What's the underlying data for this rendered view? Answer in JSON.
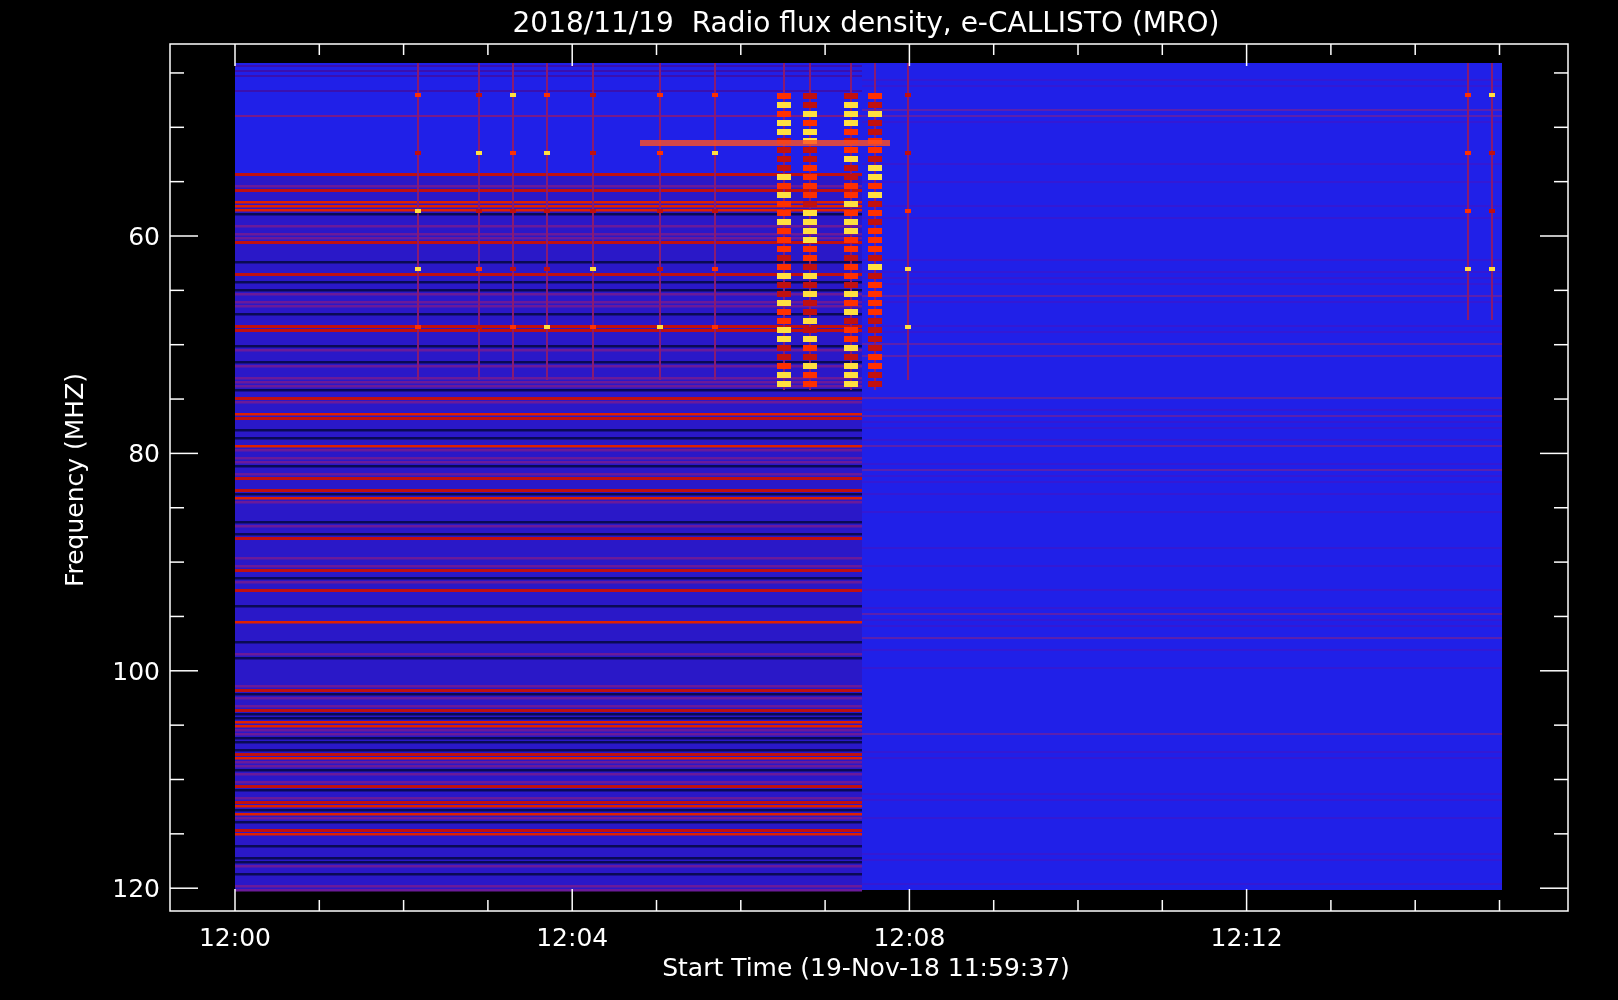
{
  "chart": {
    "title": "2018/11/19  Radio flux density, e-CALLISTO (MRO)",
    "y_axis": {
      "title": "Frequency (MHZ)",
      "ticks": [
        "60",
        "80",
        "100",
        "120"
      ]
    },
    "x_axis": {
      "title": "Start Time (19-Nov-18 11:59:37)",
      "ticks": [
        "12:00",
        "12:04",
        "12:08",
        "12:12"
      ]
    }
  }
}
